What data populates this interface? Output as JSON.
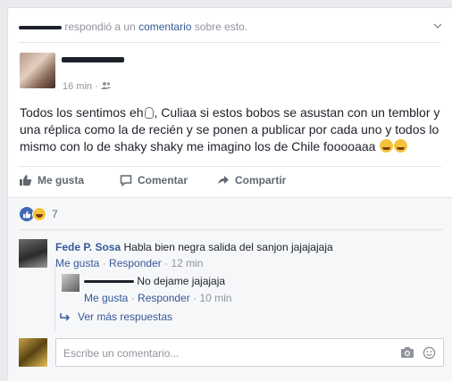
{
  "header": {
    "name_scribbled": "Fl— B——",
    "text1": " respondió a un ",
    "link": "comentario",
    "text2": " sobre esto."
  },
  "post": {
    "author_scribbled": "Fl— B——",
    "time": "16 min",
    "audience_icon": "friends-icon",
    "text_part1": "Todos los sentimos eh",
    "text_part2": ", Culiaa si estos bobos se asustan con un temblor y una réplica como la de recién y se ponen a publicar por cada uno y todos lo mismo con lo de shaky shaky me imagino los de Chile fooooaaa"
  },
  "actions": {
    "like": "Me gusta",
    "comment": "Comentar",
    "share": "Compartir"
  },
  "reactions": {
    "count": "7"
  },
  "comments": [
    {
      "name": "Fede P. Sosa",
      "text": "Habla bien negra salida del sanjon jajajajaja",
      "like": "Me gusta",
      "reply": "Responder",
      "time": "12 min"
    }
  ],
  "reply": {
    "text": "No dejame jajajaja",
    "like": "Me gusta",
    "reply": "Responder",
    "time": "10 min"
  },
  "more_replies": "Ver más respuestas",
  "comment_input": {
    "placeholder": "Escribe un comentario..."
  },
  "colors": {
    "link": "#365899",
    "meta": "#90949c",
    "like_blue": "#4267b2",
    "haha_yellow": "#f5c33b"
  }
}
